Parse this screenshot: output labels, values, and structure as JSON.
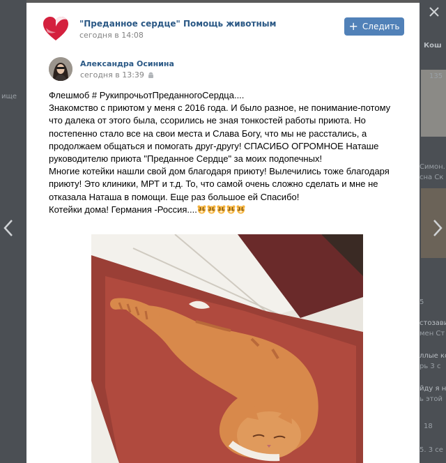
{
  "group": {
    "name": "\"Преданное сердце\" Помощь животным",
    "time": "сегодня в 14:08",
    "follow_label": "Следить"
  },
  "author": {
    "name": "Александра Осинина",
    "time": "сегодня в 13:39"
  },
  "post": {
    "lines": [
      "Флешмоб # РукипрочьотПреданногоСердца....",
      "Знакомство с приютом у меня с 2016 года. И было разное, не понимание-потому",
      "что далека от этого была, ссорились не зная тонкостей работы приюта. Но",
      "постепенно стало все на свои места и Слава Богу, что мы не расстались, а",
      "продолжаем общаться и помогать друг-другу! СПАСИБО ОГРОМНОЕ Наташе",
      "руководителю приюта \"Преданное Сердце\" за моих подопечных!",
      "Многие котейки нашли свой дом благодаря приюту! Вылечились тоже благодаря",
      "приюту! Это клиники, МРТ и т.д. То, что самой очень сложно сделать и мне не",
      "отказала Наташа в помощи. Еще раз большое ей Спасибо!",
      "Котейки дома! Германия -Россия...."
    ],
    "emoji_count": 5
  },
  "background": {
    "left": [
      "ище"
    ],
    "right": [
      "Кош",
      "135",
      "Симон. С",
      "сна Ск",
      "5",
      "стозави",
      "мен Ст",
      "ллые кош",
      "рь 3 с",
      "йду я н",
      "ь этой",
      "18",
      "5. 3 се"
    ]
  },
  "colors": {
    "link": "#2a5885",
    "button": "#5181b8",
    "muted": "#828282",
    "logo": "#d4213e"
  },
  "icons": {
    "prev": "chevron-left-icon",
    "next": "chevron-right-icon",
    "close": "close-icon",
    "device": "android-icon"
  }
}
